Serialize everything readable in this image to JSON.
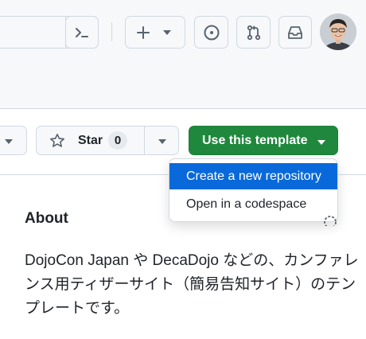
{
  "colors": {
    "accent_green": "#1f883d",
    "menu_highlight": "#0969da",
    "border": "#d1d9e0",
    "header_bg": "#f6f8fa"
  },
  "global_nav": {
    "icons": [
      "command-palette-icon",
      "plus-icon",
      "chevron-down-icon",
      "issues-icon",
      "pull-requests-icon",
      "inbox-icon"
    ]
  },
  "repo_actions": {
    "star_label": "Star",
    "star_count": "0",
    "template_button_label": "Use this template",
    "template_menu": [
      {
        "label": "Create a new repository",
        "highlighted": true
      },
      {
        "label": "Open in a codespace",
        "highlighted": false
      }
    ]
  },
  "about": {
    "title": "About",
    "description": "DojoCon Japan や DecaDojo などの、カンファレンス用ティザーサイト（簡易告知サイト）のテンプレートです。"
  }
}
